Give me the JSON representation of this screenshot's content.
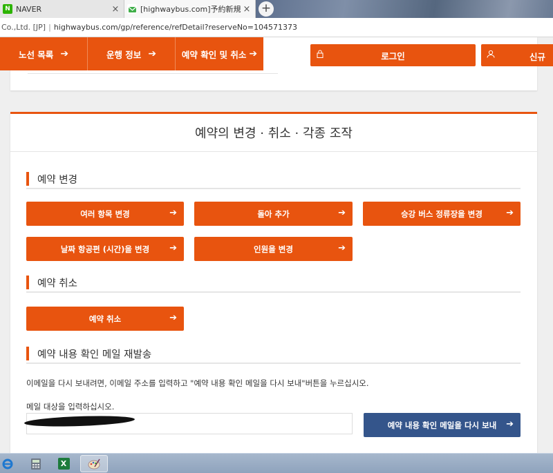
{
  "browser": {
    "tabs": [
      {
        "title": "NAVER",
        "favicon": "naver-favicon",
        "close": "×"
      },
      {
        "title": "[highwaybus.com]予約新規受付",
        "favicon": "mail-favicon",
        "close": "×"
      }
    ],
    "new_tab": "+",
    "address": {
      "org": "Co.,Ltd. [JP]",
      "separator": "|",
      "url": "highwaybus.com/gp/reference/refDetail?reserveNo=104571373"
    }
  },
  "nav": {
    "items": [
      {
        "label": "노선 목록",
        "arrow": "➔"
      },
      {
        "label": "운행 정보",
        "arrow": "➔"
      },
      {
        "label": "예약 확인 및 취소",
        "arrow": "➔"
      }
    ],
    "login_label": "로그인",
    "signup_label": "신규"
  },
  "main": {
    "title": "예약의 변경 · 취소 · 각종 조작",
    "change_section": {
      "heading": "예약 변경",
      "buttons": [
        "여러 항목 변경",
        "돌아 추가",
        "승강 버스 정류장을 변경",
        "날짜 항공편 (시간)을 변경",
        "인원을 변경"
      ]
    },
    "cancel_section": {
      "heading": "예약 취소",
      "button": "예약 취소"
    },
    "resend_section": {
      "heading": "예약 내용 확인 메일 재발송",
      "description": "이메일을 다시 보내려면, 이메일 주소를 입력하고 \"예약 내용 확인 메일을 다시 보내\"버튼을 누르십시오.",
      "input_label": "메일 대상을 입력하십시오.",
      "email_value": "",
      "send_button": "예약 내용 확인 메일을 다시 보내"
    },
    "arrow": "➔"
  },
  "colors": {
    "accent": "#e8540f",
    "send_button": "#34558b"
  },
  "taskbar": {
    "items": [
      "ie-icon",
      "calculator-icon",
      "excel-icon",
      "paint-icon"
    ]
  }
}
